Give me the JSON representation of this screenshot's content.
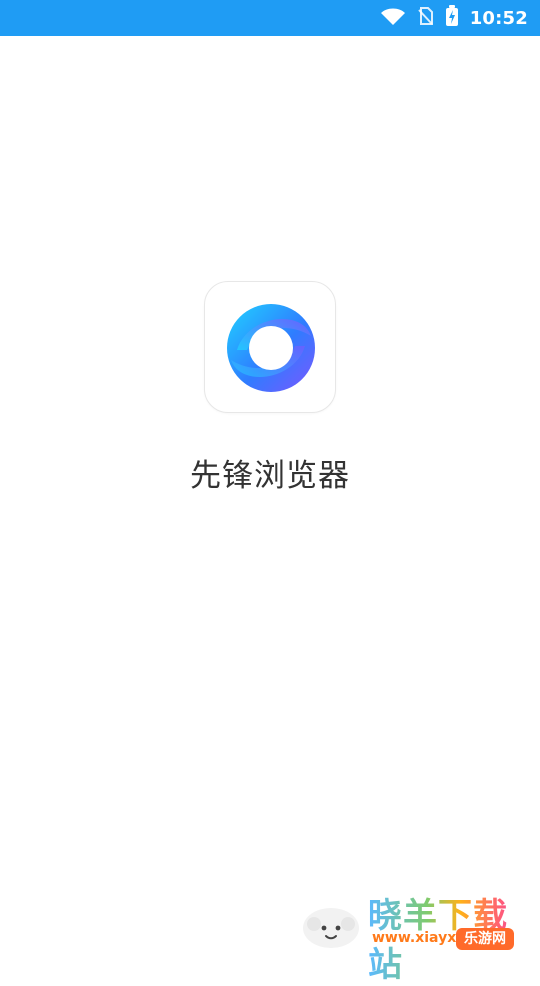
{
  "status_bar": {
    "time": "10:52",
    "icons": [
      "wifi-icon",
      "no-sim-icon",
      "battery-charging-icon"
    ],
    "colors": {
      "background": "#1f9cf4",
      "foreground": "#ffffff"
    }
  },
  "splash": {
    "app_name": "先锋浏览器",
    "icon": "pioneer-browser-logo-icon",
    "colors": {
      "logo_primary": "#2f7cff",
      "logo_secondary": "#7b57ff",
      "logo_accent": "#20d3ff"
    }
  },
  "watermark": {
    "title": "晓羊下载站",
    "domain": "www.xiayx.com",
    "badge": "乐游网",
    "icon": "sheep-icon"
  }
}
